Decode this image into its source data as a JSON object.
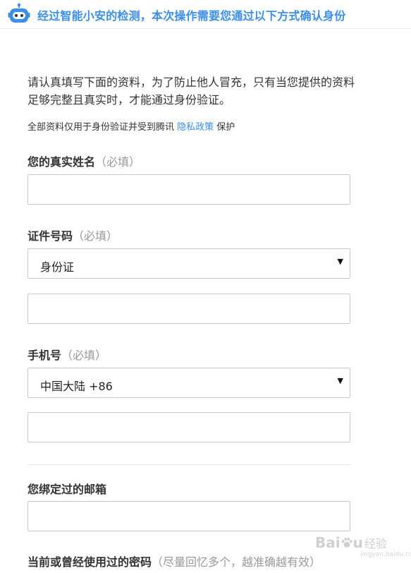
{
  "header": {
    "icon": "robot-icon",
    "title": "经过智能小安的检测，本次操作需要您通过以下方式确认身份"
  },
  "intro": {
    "text": "请认真填写下面的资料，为了防止他人冒充，只有当您提供的资料足够完整且真实时，才能通过身份验证。",
    "privacy_prefix": "全部资料仅用于身份验证并受到腾讯 ",
    "privacy_link": "隐私政策",
    "privacy_suffix": " 保护"
  },
  "form": {
    "name": {
      "label": "您的真实姓名",
      "hint": "（必填）",
      "value": ""
    },
    "id": {
      "label": "证件号码",
      "hint": "（必填）",
      "type_selected": "身份证",
      "value": ""
    },
    "phone": {
      "label": "手机号",
      "hint": "（必填）",
      "region_selected": "中国大陆 +86",
      "value": ""
    },
    "email": {
      "label": "您绑定过的邮箱",
      "value": ""
    },
    "password": {
      "label": "当前或曾经使用过的密码",
      "hint": "（尽量回忆多个，越准确越有效）"
    }
  },
  "watermark": {
    "brand": "Bai",
    "brand_end": "u",
    "cn": "经验",
    "sub": "jingyan.baidu.com"
  },
  "colors": {
    "accent": "#3c8ee6",
    "text": "#333333",
    "hint": "#999999",
    "border": "#c9c9c9"
  }
}
